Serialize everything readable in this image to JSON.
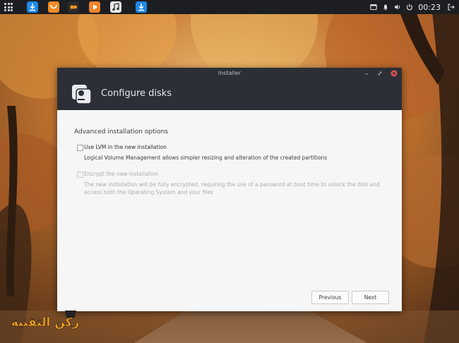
{
  "panel": {
    "clock": "00:23",
    "launchers": [
      "download-icon",
      "orange-box-icon",
      "sublime-icon",
      "play-icon",
      "music-icon",
      "download-icon"
    ],
    "tray_icons": [
      "window-icon",
      "bell-icon",
      "volume-icon",
      "power-icon"
    ],
    "logout_icon": "logout-icon"
  },
  "window": {
    "title": "Installer",
    "header_title": "Configure disks",
    "section_title": "Advanced installation options",
    "lvm": {
      "label": "Use LVM in the new installation",
      "description": "Logical Volume Management allows simpler resizing and alteration of the created partitions"
    },
    "encrypt": {
      "label": "Encrypt the new installation",
      "description": "The new installation will be fully encrypted, requiring the use of a password at boot time to unlock the disk and access both the Operating System and your files"
    },
    "previous_label": "Previous",
    "next_label": "Next"
  },
  "watermark": {
    "text": "ركن التقنية"
  },
  "colors": {
    "panel_bg": "#1c1e22",
    "header_bg": "#2c2f36",
    "content_bg": "#f6f6f6",
    "close_button": "#e05252",
    "launcher_blue": "#1e88e5"
  }
}
